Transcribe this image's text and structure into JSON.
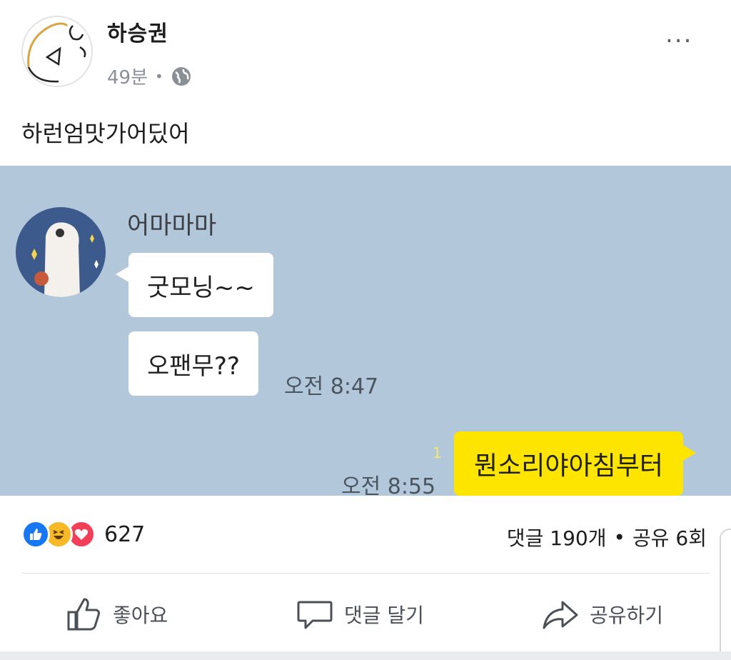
{
  "post": {
    "author": "하승권",
    "time": "49분",
    "separator": "•",
    "privacy_icon": "globe-icon",
    "text": "하런엄맛가어딨어",
    "more_label": "..."
  },
  "chat": {
    "sender": "어마마마",
    "messages": [
      {
        "text": "굿모닝~~"
      },
      {
        "text": "오팬무??"
      }
    ],
    "time_1": "오전 8:47",
    "reply": "뭔소리야아침부터",
    "unread": "1",
    "time_2": "오전 8:55",
    "colors": {
      "background": "#b2c7da",
      "my_bubble": "#fee500",
      "their_bubble": "#ffffff"
    }
  },
  "reactions": {
    "icons": [
      "like-icon",
      "haha-icon",
      "love-icon"
    ],
    "count": "627"
  },
  "stats": {
    "comments": "댓글 190개",
    "separator": "•",
    "shares": "공유 6회"
  },
  "actions": {
    "like": "좋아요",
    "comment": "댓글 달기",
    "share": "공유하기"
  },
  "colors": {
    "accent": "#1877f2",
    "haha": "#f7b928",
    "love": "#f33e58"
  }
}
